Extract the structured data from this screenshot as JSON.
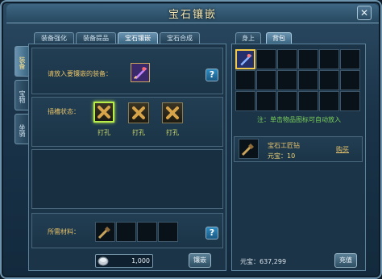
{
  "window": {
    "title": "宝石镶嵌",
    "close_glyph": "✕"
  },
  "top_tabs": [
    "装备强化",
    "装备提品",
    "宝石镶嵌",
    "宝石合成"
  ],
  "side_tabs": [
    "装备",
    "宝物",
    "坐骑"
  ],
  "inventory_tabs": [
    "身上",
    "背包"
  ],
  "equip_section": {
    "label": "请放入要镶嵌的装备：",
    "help": "?"
  },
  "slots_section": {
    "label": "插槽状态：",
    "slot_states": [
      "打孔",
      "打孔",
      "打孔"
    ],
    "help": "?"
  },
  "materials_section": {
    "label": "所需材料：",
    "help": "?"
  },
  "cost": {
    "amount": "1,000",
    "action_label": "镶嵌"
  },
  "inventory_hint": "注：单击物品图标可自动放入",
  "material_item": {
    "name": "宝石工匠钻",
    "price": "元宝：10",
    "buy_label": "购买"
  },
  "yuanbao": {
    "label": "元宝：637,299",
    "recharge_label": "充值"
  },
  "colors": {
    "accent": "#e8c36a",
    "highlight": "#b9ee4a",
    "panel": "#1b3448"
  }
}
